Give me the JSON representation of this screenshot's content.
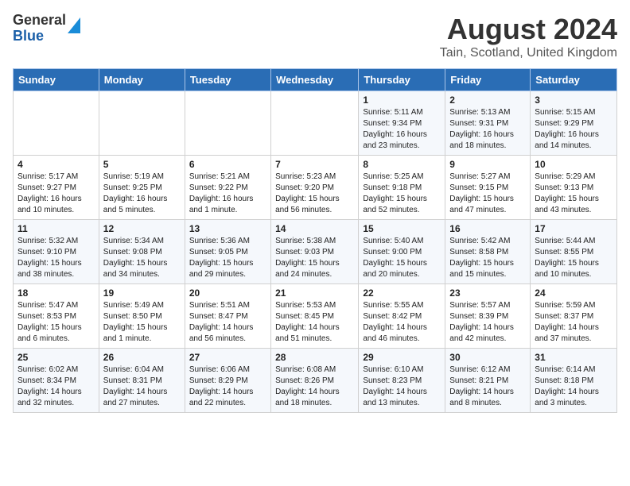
{
  "logo": {
    "general": "General",
    "blue": "Blue"
  },
  "title": "August 2024",
  "subtitle": "Tain, Scotland, United Kingdom",
  "days_of_week": [
    "Sunday",
    "Monday",
    "Tuesday",
    "Wednesday",
    "Thursday",
    "Friday",
    "Saturday"
  ],
  "weeks": [
    [
      {
        "day": "",
        "info": ""
      },
      {
        "day": "",
        "info": ""
      },
      {
        "day": "",
        "info": ""
      },
      {
        "day": "",
        "info": ""
      },
      {
        "day": "1",
        "info": "Sunrise: 5:11 AM\nSunset: 9:34 PM\nDaylight: 16 hours\nand 23 minutes."
      },
      {
        "day": "2",
        "info": "Sunrise: 5:13 AM\nSunset: 9:31 PM\nDaylight: 16 hours\nand 18 minutes."
      },
      {
        "day": "3",
        "info": "Sunrise: 5:15 AM\nSunset: 9:29 PM\nDaylight: 16 hours\nand 14 minutes."
      }
    ],
    [
      {
        "day": "4",
        "info": "Sunrise: 5:17 AM\nSunset: 9:27 PM\nDaylight: 16 hours\nand 10 minutes."
      },
      {
        "day": "5",
        "info": "Sunrise: 5:19 AM\nSunset: 9:25 PM\nDaylight: 16 hours\nand 5 minutes."
      },
      {
        "day": "6",
        "info": "Sunrise: 5:21 AM\nSunset: 9:22 PM\nDaylight: 16 hours\nand 1 minute."
      },
      {
        "day": "7",
        "info": "Sunrise: 5:23 AM\nSunset: 9:20 PM\nDaylight: 15 hours\nand 56 minutes."
      },
      {
        "day": "8",
        "info": "Sunrise: 5:25 AM\nSunset: 9:18 PM\nDaylight: 15 hours\nand 52 minutes."
      },
      {
        "day": "9",
        "info": "Sunrise: 5:27 AM\nSunset: 9:15 PM\nDaylight: 15 hours\nand 47 minutes."
      },
      {
        "day": "10",
        "info": "Sunrise: 5:29 AM\nSunset: 9:13 PM\nDaylight: 15 hours\nand 43 minutes."
      }
    ],
    [
      {
        "day": "11",
        "info": "Sunrise: 5:32 AM\nSunset: 9:10 PM\nDaylight: 15 hours\nand 38 minutes."
      },
      {
        "day": "12",
        "info": "Sunrise: 5:34 AM\nSunset: 9:08 PM\nDaylight: 15 hours\nand 34 minutes."
      },
      {
        "day": "13",
        "info": "Sunrise: 5:36 AM\nSunset: 9:05 PM\nDaylight: 15 hours\nand 29 minutes."
      },
      {
        "day": "14",
        "info": "Sunrise: 5:38 AM\nSunset: 9:03 PM\nDaylight: 15 hours\nand 24 minutes."
      },
      {
        "day": "15",
        "info": "Sunrise: 5:40 AM\nSunset: 9:00 PM\nDaylight: 15 hours\nand 20 minutes."
      },
      {
        "day": "16",
        "info": "Sunrise: 5:42 AM\nSunset: 8:58 PM\nDaylight: 15 hours\nand 15 minutes."
      },
      {
        "day": "17",
        "info": "Sunrise: 5:44 AM\nSunset: 8:55 PM\nDaylight: 15 hours\nand 10 minutes."
      }
    ],
    [
      {
        "day": "18",
        "info": "Sunrise: 5:47 AM\nSunset: 8:53 PM\nDaylight: 15 hours\nand 6 minutes."
      },
      {
        "day": "19",
        "info": "Sunrise: 5:49 AM\nSunset: 8:50 PM\nDaylight: 15 hours\nand 1 minute."
      },
      {
        "day": "20",
        "info": "Sunrise: 5:51 AM\nSunset: 8:47 PM\nDaylight: 14 hours\nand 56 minutes."
      },
      {
        "day": "21",
        "info": "Sunrise: 5:53 AM\nSunset: 8:45 PM\nDaylight: 14 hours\nand 51 minutes."
      },
      {
        "day": "22",
        "info": "Sunrise: 5:55 AM\nSunset: 8:42 PM\nDaylight: 14 hours\nand 46 minutes."
      },
      {
        "day": "23",
        "info": "Sunrise: 5:57 AM\nSunset: 8:39 PM\nDaylight: 14 hours\nand 42 minutes."
      },
      {
        "day": "24",
        "info": "Sunrise: 5:59 AM\nSunset: 8:37 PM\nDaylight: 14 hours\nand 37 minutes."
      }
    ],
    [
      {
        "day": "25",
        "info": "Sunrise: 6:02 AM\nSunset: 8:34 PM\nDaylight: 14 hours\nand 32 minutes."
      },
      {
        "day": "26",
        "info": "Sunrise: 6:04 AM\nSunset: 8:31 PM\nDaylight: 14 hours\nand 27 minutes."
      },
      {
        "day": "27",
        "info": "Sunrise: 6:06 AM\nSunset: 8:29 PM\nDaylight: 14 hours\nand 22 minutes."
      },
      {
        "day": "28",
        "info": "Sunrise: 6:08 AM\nSunset: 8:26 PM\nDaylight: 14 hours\nand 18 minutes."
      },
      {
        "day": "29",
        "info": "Sunrise: 6:10 AM\nSunset: 8:23 PM\nDaylight: 14 hours\nand 13 minutes."
      },
      {
        "day": "30",
        "info": "Sunrise: 6:12 AM\nSunset: 8:21 PM\nDaylight: 14 hours\nand 8 minutes."
      },
      {
        "day": "31",
        "info": "Sunrise: 6:14 AM\nSunset: 8:18 PM\nDaylight: 14 hours\nand 3 minutes."
      }
    ]
  ]
}
